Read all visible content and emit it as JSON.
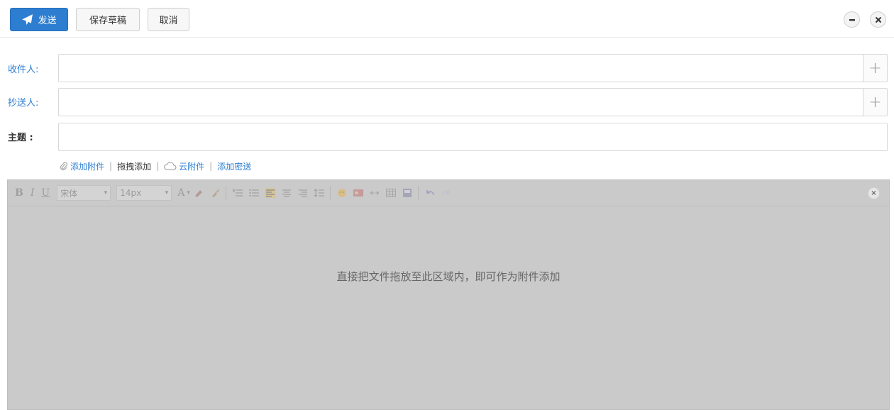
{
  "toolbar": {
    "send_label": "发送",
    "save_draft_label": "保存草稿",
    "cancel_label": "取消",
    "minimize_icon": "minus-icon",
    "close_icon": "close-icon"
  },
  "fields": {
    "to_label": "收件人:",
    "cc_label": "抄送人:",
    "subject_label": "主题 :",
    "to_value": "",
    "cc_value": "",
    "subject_value": "",
    "add_symbol": "+"
  },
  "attachments": {
    "add_attachment": "添加附件",
    "drag_add": "拖拽添加",
    "cloud_attachment": "云附件",
    "add_bcc": "添加密送",
    "separator": "|"
  },
  "editor": {
    "bold": "B",
    "italic": "I",
    "underline": "U",
    "font_family": "宋体",
    "font_size": "14px",
    "font_color": "A",
    "drop_hint": "直接把文件拖放至此区域内，即可作为附件添加",
    "close_symbol": "×"
  },
  "colors": {
    "accent": "#2d7ed0",
    "overlay": "#cacaca"
  }
}
